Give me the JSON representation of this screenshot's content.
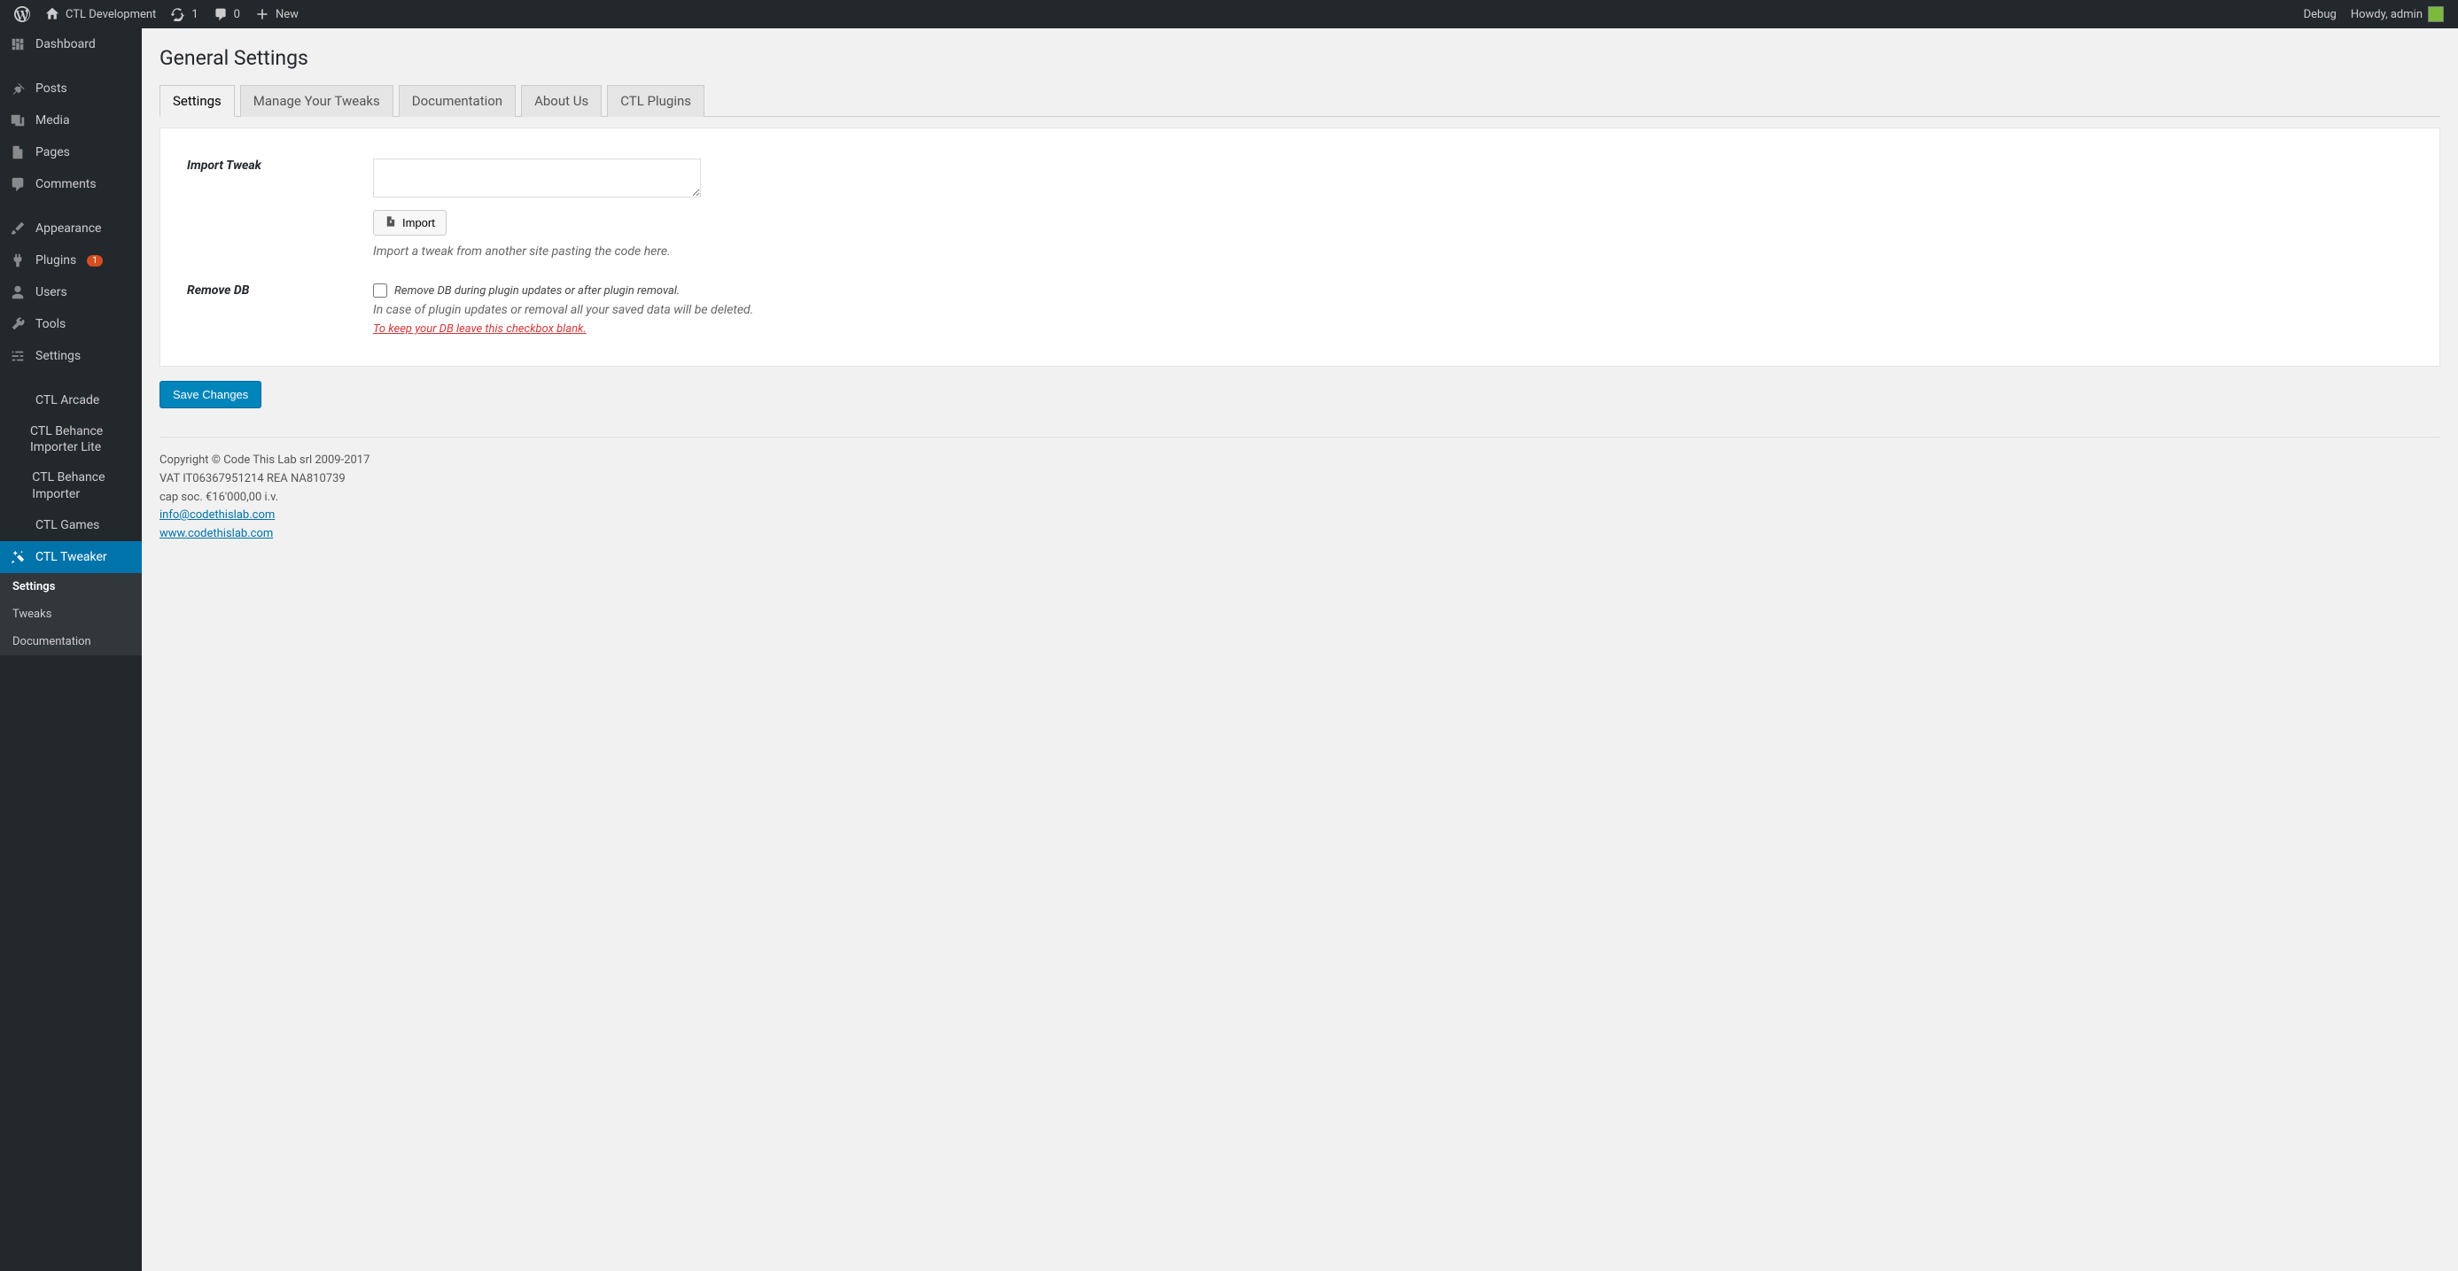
{
  "admin_bar": {
    "site_name": "CTL Development",
    "updates_count": "1",
    "comments_count": "0",
    "new_label": "New",
    "debug_label": "Debug",
    "howdy_label": "Howdy, admin"
  },
  "sidebar": {
    "items": [
      {
        "label": "Dashboard",
        "icon": "dashboard-icon"
      },
      {
        "label": "Posts",
        "icon": "pin-icon"
      },
      {
        "label": "Media",
        "icon": "media-icon"
      },
      {
        "label": "Pages",
        "icon": "page-icon"
      },
      {
        "label": "Comments",
        "icon": "comment-icon"
      },
      {
        "label": "Appearance",
        "icon": "brush-icon"
      },
      {
        "label": "Plugins",
        "icon": "plug-icon",
        "badge": "1"
      },
      {
        "label": "Users",
        "icon": "user-icon"
      },
      {
        "label": "Tools",
        "icon": "wrench-icon"
      },
      {
        "label": "Settings",
        "icon": "sliders-icon"
      },
      {
        "label": "CTL Arcade"
      },
      {
        "label": "CTL Behance Importer Lite"
      },
      {
        "label": "CTL Behance Importer"
      },
      {
        "label": "CTL Games"
      },
      {
        "label": "CTL Tweaker",
        "icon": "wand-icon",
        "current": true
      }
    ],
    "submenu": [
      {
        "label": "Settings",
        "active": true
      },
      {
        "label": "Tweaks"
      },
      {
        "label": "Documentation"
      }
    ]
  },
  "page": {
    "title": "General Settings",
    "tabs": [
      {
        "label": "Settings",
        "active": true
      },
      {
        "label": "Manage Your Tweaks"
      },
      {
        "label": "Documentation"
      },
      {
        "label": "About Us"
      },
      {
        "label": "CTL Plugins"
      }
    ]
  },
  "form": {
    "import_label": "Import Tweak",
    "import_button": "Import",
    "import_desc": "Import a tweak from another site pasting the code here.",
    "remove_db_label": "Remove DB",
    "remove_db_checkbox_label": "Remove DB during plugin updates or after plugin removal.",
    "remove_db_desc": "In case of plugin updates or removal all your saved data will be deleted.",
    "remove_db_warn": "To keep your DB leave this checkbox blank.",
    "save_button": "Save Changes"
  },
  "footer": {
    "copyright": "Copyright © Code This Lab srl 2009-2017",
    "vat": "VAT IT06367951214 REA NA810739",
    "cap": "cap soc. €16'000,00 i.v.",
    "email": "info@codethislab.com",
    "website": "www.codethislab.com"
  }
}
